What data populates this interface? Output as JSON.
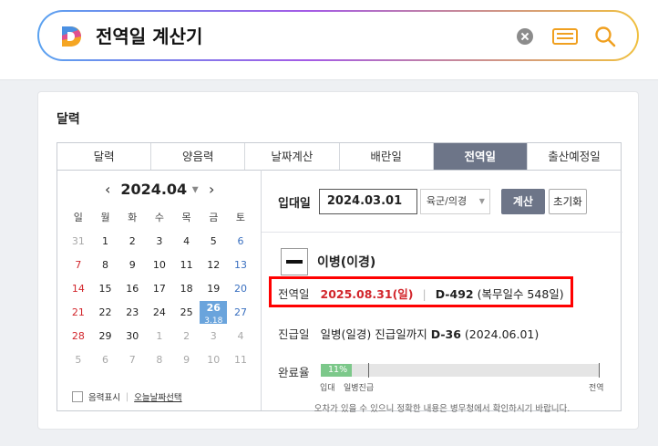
{
  "search": {
    "query": "전역일 계산기"
  },
  "card": {
    "title": "달력"
  },
  "tabs": [
    {
      "label": "달력"
    },
    {
      "label": "양음력"
    },
    {
      "label": "날짜계산"
    },
    {
      "label": "배란일"
    },
    {
      "label": "전역일"
    },
    {
      "label": "출산예정일"
    }
  ],
  "calendar": {
    "month": "2024.04",
    "weekdays": [
      "일",
      "월",
      "화",
      "수",
      "목",
      "금",
      "토"
    ],
    "weeks": [
      [
        "31",
        "1",
        "2",
        "3",
        "4",
        "5",
        "6"
      ],
      [
        "7",
        "8",
        "9",
        "10",
        "11",
        "12",
        "13"
      ],
      [
        "14",
        "15",
        "16",
        "17",
        "18",
        "19",
        "20"
      ],
      [
        "21",
        "22",
        "23",
        "24",
        "25",
        "26",
        "27"
      ],
      [
        "28",
        "29",
        "30",
        "1",
        "2",
        "3",
        "4"
      ],
      [
        "5",
        "6",
        "7",
        "8",
        "9",
        "10",
        "11"
      ]
    ],
    "today_lunar": "3.18",
    "lunar_toggle_label": "음력표시",
    "today_link_label": "오늘날짜선택"
  },
  "form": {
    "enlist_label": "입대일",
    "enlist_date": "2024.03.01",
    "branch": "육군/의경",
    "calc_button": "계산",
    "reset_button": "초기화"
  },
  "result": {
    "rank": "이병(이경)",
    "discharge_label": "전역일",
    "discharge_date": "2025.08.31(일)",
    "dday": "D-492",
    "service_days": "(복무일수 548일)",
    "promo_label": "진급일",
    "promo_text": "일병(일경) 진급일까지",
    "promo_dday": "D-36",
    "promo_date": "(2024.06.01)",
    "progress_label": "완료율",
    "progress_percent": 11,
    "progress_text": "11%",
    "marker_start": "입대",
    "marker_promo": "일병진급",
    "marker_end": "전역",
    "notice": "오차가 있을 수 있으니 정확한 내용은 병무청에서 확인하시기 바랍니다."
  },
  "colors": {
    "tab_active": "#6d7588",
    "today": "#6aa4dc",
    "highlight": "#ff0000",
    "progress": "#7cc88a",
    "sunday": "#d2262c",
    "saturday": "#3a70c0"
  }
}
